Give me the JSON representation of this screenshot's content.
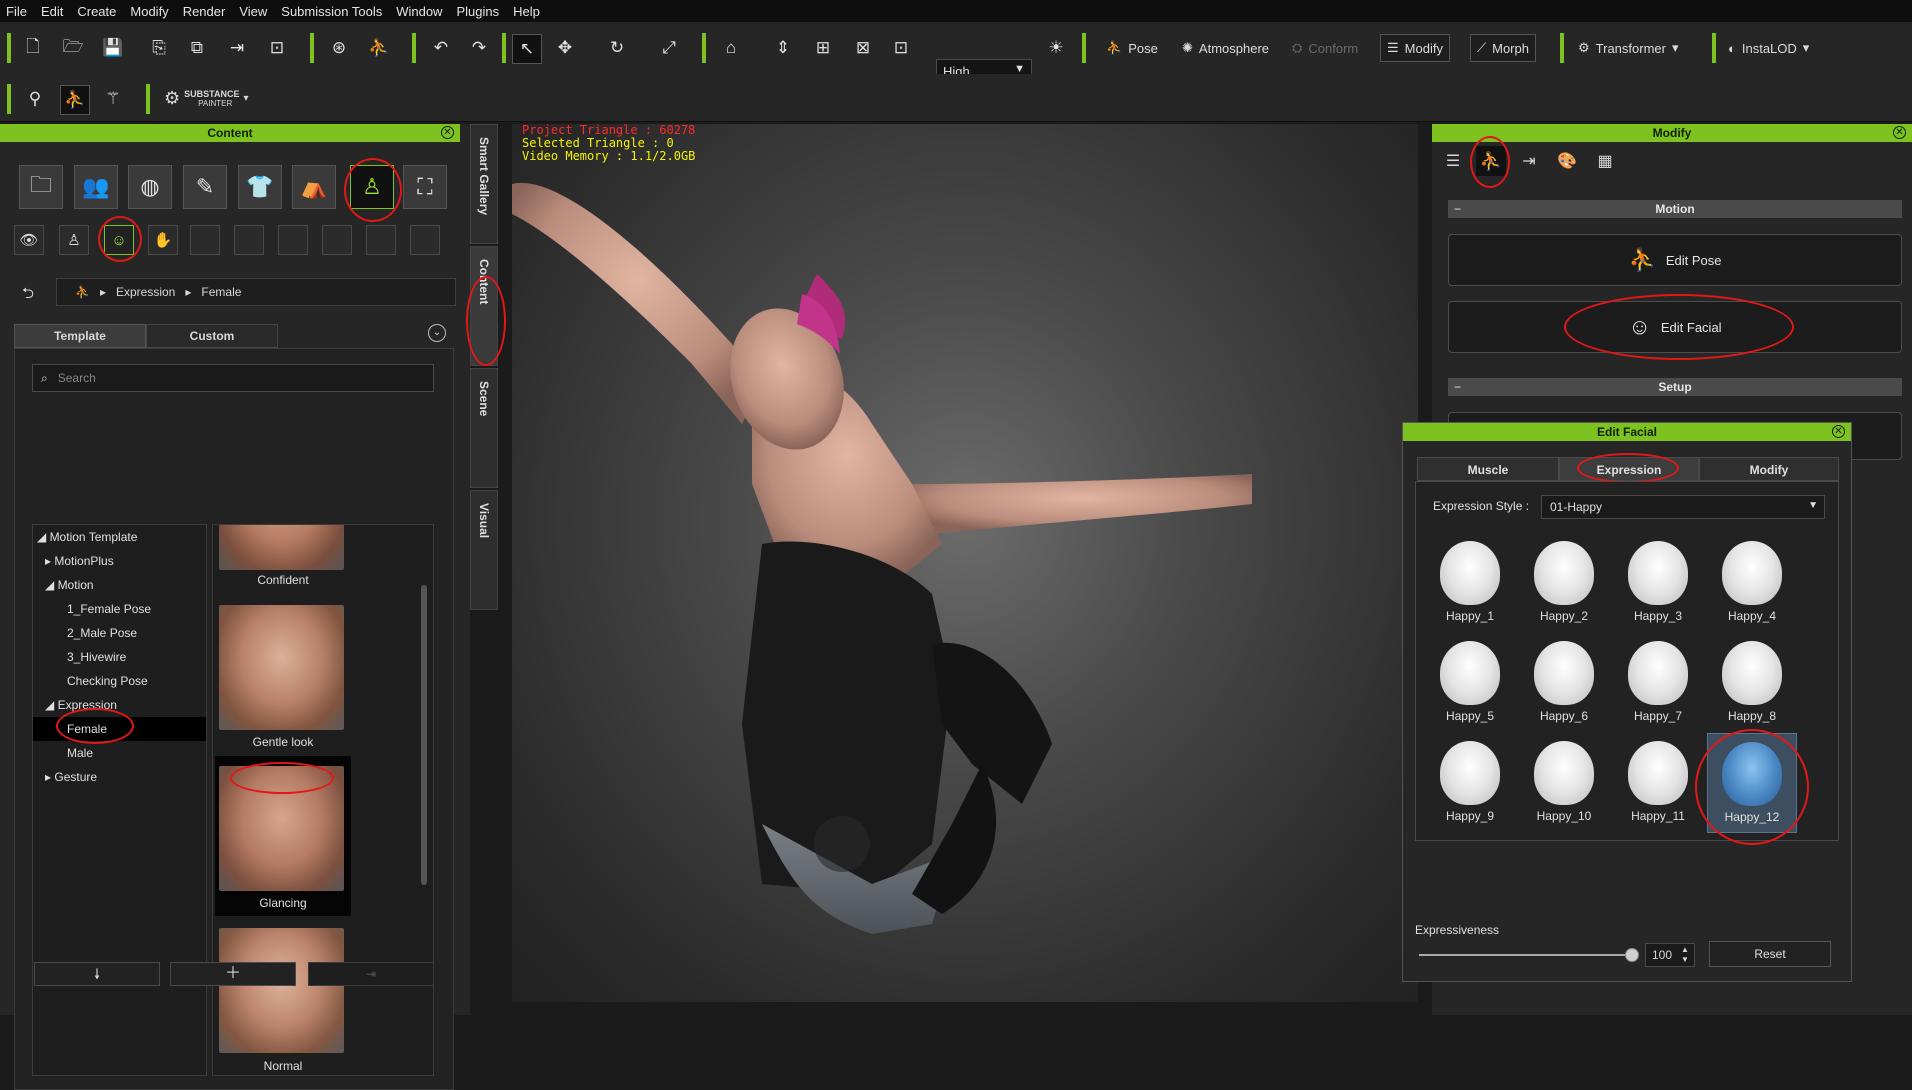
{
  "menu": [
    "File",
    "Edit",
    "Create",
    "Modify",
    "Render",
    "View",
    "Submission Tools",
    "Window",
    "Plugins",
    "Help"
  ],
  "toolbar": {
    "quality": "High",
    "pose_label": "Pose",
    "atmosphere_label": "Atmosphere",
    "conform_label": "Conform",
    "modify_label": "Modify",
    "morph_label": "Morph",
    "transformer_label": "Transformer",
    "instalod_label": "InstaLOD",
    "substance_label_1": "SUBSTANCE",
    "substance_label_2": "PAINTER"
  },
  "content_panel": {
    "title": "Content",
    "breadcrumb": [
      "Expression",
      "Female"
    ],
    "tabs": [
      "Template",
      "Custom"
    ],
    "search_placeholder": "Search",
    "tree": [
      "Motion Template",
      "MotionPlus",
      "Motion",
      "1_Female Pose",
      "2_Male Pose",
      "3_Hivewire",
      "Checking Pose",
      "Expression",
      "Female",
      "Male",
      "Gesture"
    ],
    "thumbnails": [
      "Confident",
      "Gentle look",
      "Glancing",
      "Normal"
    ]
  },
  "side_tabs": [
    "Smart Gallery",
    "Content",
    "Scene",
    "Visual"
  ],
  "viewport": {
    "project_triangle": "Project Triangle : 60278",
    "selected_triangle": "Selected Triangle : 0",
    "video_memory": "Video Memory : 1.1/2.0GB"
  },
  "modify_panel": {
    "title": "Modify",
    "motion_section": "Motion",
    "edit_pose": "Edit Pose",
    "edit_facial": "Edit Facial",
    "setup_section": "Setup"
  },
  "edit_facial": {
    "title": "Edit Facial",
    "tabs": [
      "Muscle",
      "Expression",
      "Modify"
    ],
    "style_label": "Expression Style :",
    "style_value": "01-Happy",
    "expressions": [
      "Happy_1",
      "Happy_2",
      "Happy_3",
      "Happy_4",
      "Happy_5",
      "Happy_6",
      "Happy_7",
      "Happy_8",
      "Happy_9",
      "Happy_10",
      "Happy_11",
      "Happy_12"
    ],
    "expressiveness_label": "Expressiveness",
    "expressiveness_value": "100",
    "reset": "Reset"
  },
  "colors": {
    "accent": "#7dc21e",
    "annotation": "#e01818",
    "stat_red": "#ff2a2a",
    "stat_yellow": "#f4f400"
  }
}
